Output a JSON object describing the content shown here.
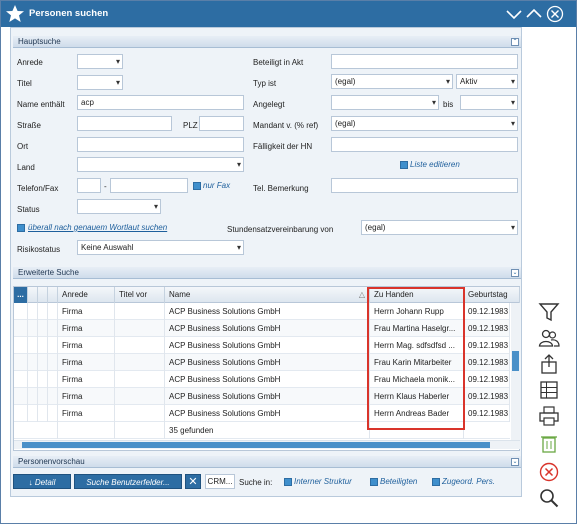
{
  "window": {
    "title": "Personen suchen"
  },
  "hauptsuche": {
    "title": "Hauptsuche",
    "anrede_label": "Anrede",
    "titel_label": "Titel",
    "name_label": "Name enthält",
    "name_value": "acp",
    "strasse_label": "Straße",
    "plz_label": "PLZ",
    "ort_label": "Ort",
    "land_label": "Land",
    "telefon_label": "Telefon/Fax",
    "telefon_sep": "-",
    "nur_fax": "nur Fax",
    "status_label": "Status",
    "ueberall_link": "überall nach genauem Wortlaut suchen",
    "risikostatus_label": "Risikostatus",
    "risikostatus_value": "Keine Auswahl",
    "beteiligt_label": "Beteiligt in Akt",
    "typ_label": "Typ ist",
    "typ_value": "(egal)",
    "typ_state": "Aktiv",
    "angelegt_label": "Angelegt",
    "bis_label": "bis",
    "mandant_label": "Mandant v. (% ref)",
    "mandant_value": "(egal)",
    "faelligkeit_label": "Fälligkeit der HN",
    "liste_editieren": "Liste editieren",
    "tel_bemerkung_label": "Tel. Bemerkung",
    "stundensatz_label": "Stundensatzvereinbarung von",
    "stundensatz_value": "(egal)"
  },
  "erweiterte": {
    "title": "Erweiterte Suche"
  },
  "table": {
    "columns": [
      "...",
      "Anrede",
      "Titel vor",
      "Name",
      "Zu Handen",
      "Geburtstag"
    ],
    "rows": [
      {
        "anrede": "Firma",
        "name": "ACP Business Solutions GmbH",
        "zu_handen": "Herrn Johann Rupp",
        "geburtstag": "09.12.1983"
      },
      {
        "anrede": "Firma",
        "name": "ACP Business Solutions GmbH",
        "zu_handen": "Frau Martina Haselgr...",
        "geburtstag": "09.12.1983"
      },
      {
        "anrede": "Firma",
        "name": "ACP Business Solutions GmbH",
        "zu_handen": "Herrn Mag. sdfsdfsd ...",
        "geburtstag": "09.12.1983"
      },
      {
        "anrede": "Firma",
        "name": "ACP Business Solutions GmbH",
        "zu_handen": "Frau Karin Mitarbeiter",
        "geburtstag": "09.12.1983"
      },
      {
        "anrede": "Firma",
        "name": "ACP Business Solutions GmbH",
        "zu_handen": "Frau Michaela monik...",
        "geburtstag": "09.12.1983"
      },
      {
        "anrede": "Firma",
        "name": "ACP Business Solutions GmbH",
        "zu_handen": "Herrn Klaus Haberler",
        "geburtstag": "09.12.1983"
      },
      {
        "anrede": "Firma",
        "name": "ACP Business Solutions GmbH",
        "zu_handen": "Herrn Andreas Bader",
        "geburtstag": "09.12.1983"
      }
    ],
    "found": "35 gefunden"
  },
  "personenvorschau": {
    "title": "Personenvorschau"
  },
  "bottom": {
    "detail": "Detail",
    "suche_benutzer": "Suche Benutzerfelder...",
    "crm": "CRM...",
    "suche_in": "Suche in:",
    "interne": "Interner Struktur",
    "beteiligten": "Beteiligten",
    "zugeord": "Zugeord. Pers."
  },
  "colors": {
    "titlebar": "#2d6da3",
    "accent": "#3f8fcc",
    "highlight": "#d9342b"
  }
}
